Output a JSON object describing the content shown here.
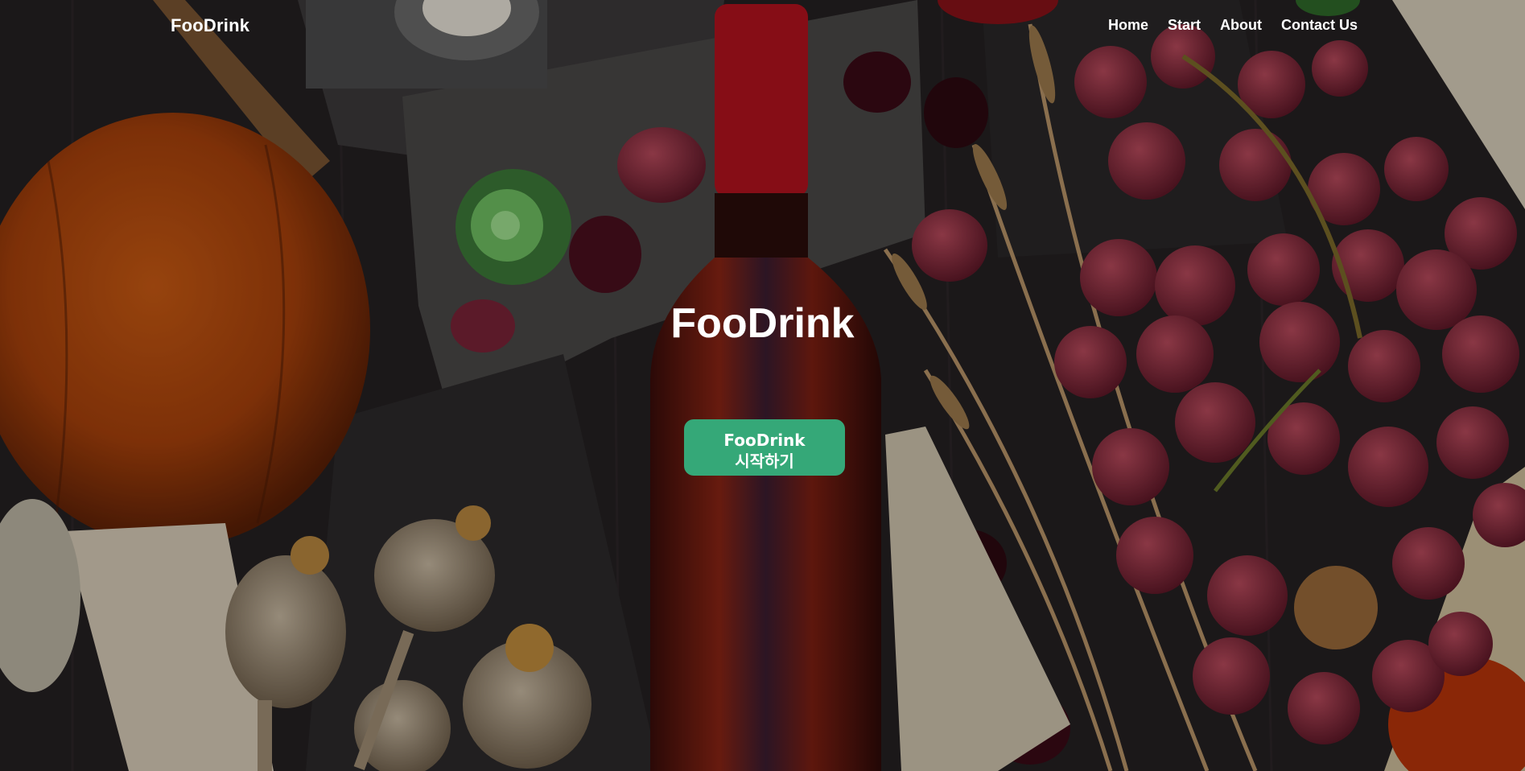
{
  "navbar": {
    "brand": "FooDrink",
    "links": [
      "Home",
      "Start",
      "About",
      "Contact Us"
    ]
  },
  "hero": {
    "title": "FooDrink",
    "cta_line1": "FooDrink",
    "cta_line2": "시작하기"
  },
  "colors": {
    "cta_background": "#35a878",
    "text": "#ffffff",
    "background_dark": "#1c1a1b"
  }
}
